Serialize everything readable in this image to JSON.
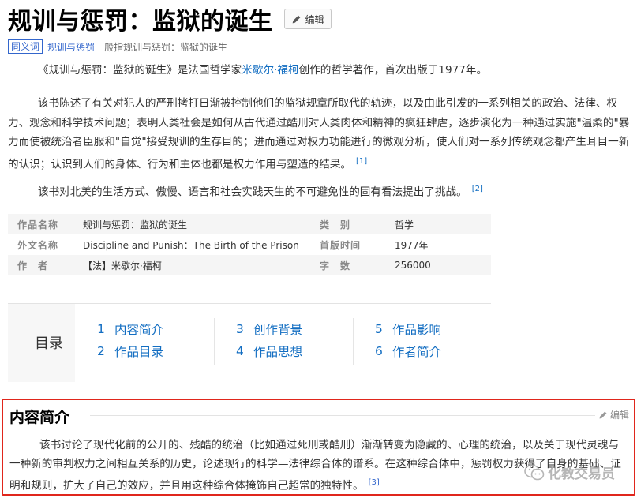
{
  "header": {
    "title": "规训与惩罚：监狱的诞生",
    "edit_label": "编辑"
  },
  "synonym": {
    "tag": "同义词",
    "link": "规训与惩罚",
    "rest": "一般指规训与惩罚：监狱的诞生"
  },
  "intro": {
    "p1_a": "《规训与惩罚：监狱的诞生》是法国哲学家",
    "p1_link": "米歇尔·福柯",
    "p1_b": "创作的哲学著作，首次出版于1977年。",
    "p2": "该书陈述了有关对犯人的严刑拷打日渐被控制他们的监狱规章所取代的轨迹，以及由此引发的一系列相关的政治、法律、权力、观念和科学技术问题；表明人类社会是如何从古代通过酷刑对人类肉体和精神的疯狂肆虐，逐步演化为一种通过实施\"温柔的\"暴力而使被统治者臣服和\"自觉\"接受规训的生存目的；进而通过对权力功能进行的微观分析，使人们对一系列传统观念都产生耳目一新的认识；认识到人们的身体、行为和主体也都是权力作用与塑造的结果。",
    "p2_ref": "[1]",
    "p3": "该书对北美的生活方式、傲慢、语言和社会实践天生的不可避免性的固有看法提出了挑战。",
    "p3_ref": "[2]"
  },
  "info": [
    {
      "k1": "作品名称",
      "v1": "规训与惩罚：监狱的诞生",
      "k2": "类　别",
      "v2": "哲学"
    },
    {
      "k1": "外文名称",
      "v1": "Discipline and Punish：The Birth of the Prison",
      "k2": "首版时间",
      "v2": "1977年"
    },
    {
      "k1": "作　者",
      "v1": "【法】米歇尔·福柯",
      "k2": "字　数",
      "v2": "256000"
    }
  ],
  "toc": {
    "label": "目录",
    "items": [
      {
        "n": "1",
        "label": "内容简介"
      },
      {
        "n": "2",
        "label": "作品目录"
      },
      {
        "n": "3",
        "label": "创作背景"
      },
      {
        "n": "4",
        "label": "作品思想"
      },
      {
        "n": "5",
        "label": "作品影响"
      },
      {
        "n": "6",
        "label": "作者简介"
      }
    ]
  },
  "section": {
    "title": "内容简介",
    "edit_label": "编辑",
    "para": "该书讨论了现代化前的公开的、残酷的统治（比如通过死刑或酷刑）渐渐转变为隐藏的、心理的统治，以及关于现代灵魂与一种新的审判权力之间相互关系的历史，论述现行的科学—法律综合体的谱系。在这种综合体中，惩罚权力获得了自身的基础、证明和规则，扩大了自己的效应，并且用这种综合体掩饰自己超常的独特性。",
    "ref": "[3]"
  },
  "watermark": {
    "text": "化教交易员"
  },
  "icons": {
    "edit": "pencil-icon",
    "watermark": "wechat-icon"
  }
}
